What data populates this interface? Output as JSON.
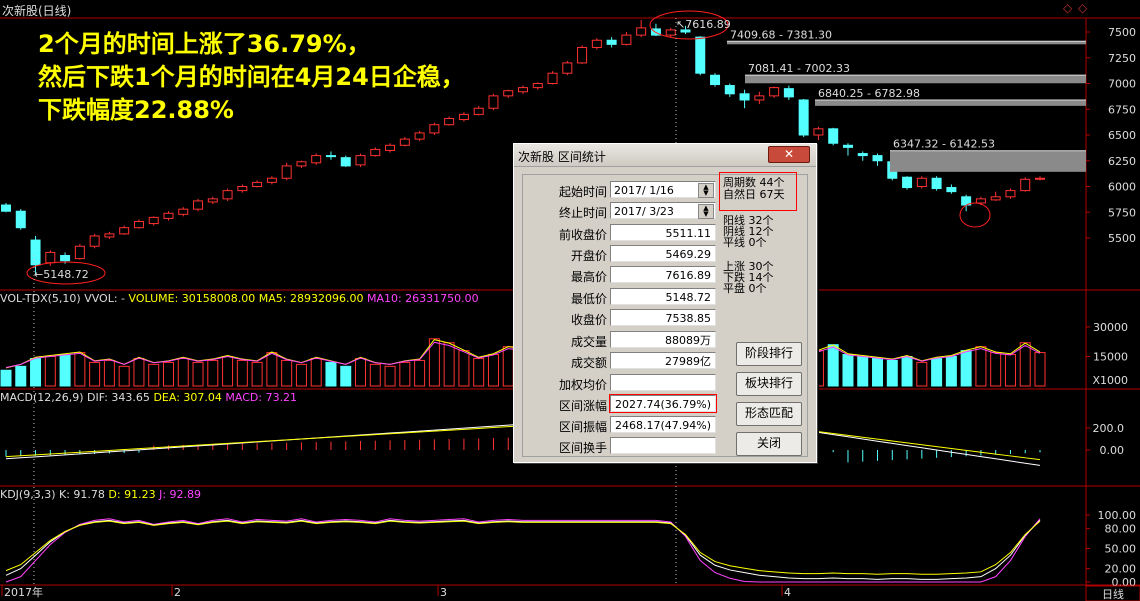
{
  "window": {
    "title": "次新股(日线)"
  },
  "annotation": {
    "lines": [
      "2个月的时间上涨了36.79%，",
      "然后下跌1个月的时间在4月24日企稳，",
      "下跌幅度22.88%"
    ]
  },
  "price_chart": {
    "y_ticks": [
      "7500",
      "7250",
      "7000",
      "6750",
      "6500",
      "6250",
      "6000",
      "5750",
      "5500"
    ],
    "high_label": "7616.89",
    "low_label": "5148.72",
    "ranges": [
      "7409.68 - 7381.30",
      "7081.41 - 7002.33",
      "6840.25 - 6782.98",
      "6347.32 - 6142.53"
    ]
  },
  "volume_panel": {
    "indicator": "VOL-TDX(5,10)",
    "vvol": "VVOL: -",
    "volume": "VOLUME: 30158008.00",
    "ma5": "MA5: 28932096.00",
    "ma10": "MA10: 26331750.00",
    "y_ticks": [
      "30000",
      "15000"
    ],
    "unit": "X1000"
  },
  "macd_panel": {
    "indicator": "MACD(12,26,9)",
    "dif": "DIF: 343.65",
    "dea": "DEA: 307.04",
    "macd": "MACD: 73.21",
    "y_ticks": [
      "200.0",
      "0.00"
    ]
  },
  "kdj_panel": {
    "indicator": "KDJ(9,3,3)",
    "k": "K: 91.78",
    "d": "D: 91.23",
    "j": "J: 92.89",
    "y_ticks": [
      "100.00",
      "80.00",
      "50.00",
      "20.00",
      "0.00"
    ]
  },
  "x_axis": {
    "labels": [
      "2017年",
      "2",
      "3",
      "4"
    ],
    "period": "日线"
  },
  "dialog": {
    "title": "次新股 区间统计",
    "close_label": "关闭",
    "fields": [
      {
        "label": "起始时间",
        "value": "2017/ 1/16",
        "kind": "date"
      },
      {
        "label": "终止时间",
        "value": "2017/ 3/23",
        "kind": "date"
      },
      {
        "label": "前收盘价",
        "value": "5511.11"
      },
      {
        "label": "开盘价",
        "value": "5469.29"
      },
      {
        "label": "最高价",
        "value": "7616.89"
      },
      {
        "label": "最低价",
        "value": "5148.72"
      },
      {
        "label": "收盘价",
        "value": "7538.85"
      },
      {
        "label": "成交量",
        "value": "88089万"
      },
      {
        "label": "成交额",
        "value": "27989亿"
      },
      {
        "label": "加权均价",
        "value": ""
      },
      {
        "label": "区间涨幅",
        "value": "2027.74(36.79%)"
      },
      {
        "label": "区间振幅",
        "value": "2468.17(47.94%)"
      },
      {
        "label": "区间换手",
        "value": ""
      }
    ],
    "stats": [
      {
        "label": "周期数",
        "value": "44个"
      },
      {
        "label": "自然日",
        "value": "67天"
      },
      {
        "label": "阳线",
        "value": "32个"
      },
      {
        "label": "阴线",
        "value": "12个"
      },
      {
        "label": "平线",
        "value": "0个"
      },
      {
        "label": "上涨",
        "value": "30个"
      },
      {
        "label": "下跌",
        "value": "14个"
      },
      {
        "label": "平盘",
        "value": "0个"
      }
    ],
    "buttons": [
      "阶段排行",
      "板块排行",
      "形态匹配",
      "关闭"
    ]
  },
  "colors": {
    "up": "#ff3232",
    "down": "#54ffff",
    "highlight": "#ff0000",
    "annotation": "#ffff00"
  }
}
